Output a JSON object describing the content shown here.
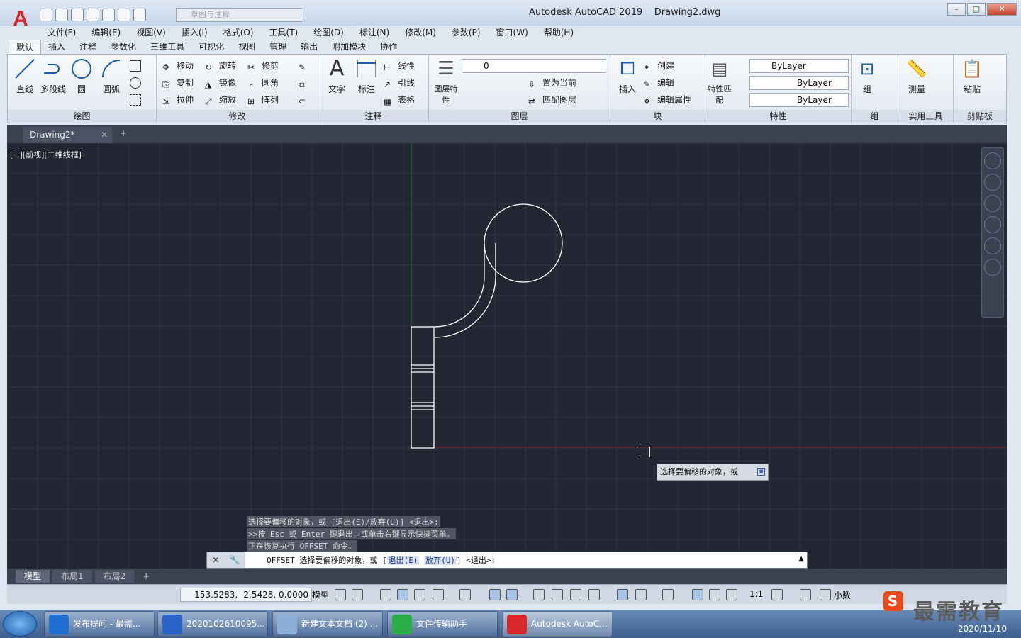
{
  "app": {
    "title": "Autodesk AutoCAD 2019",
    "document": "Drawing2.dwg",
    "logo": "A",
    "workspace": "草图与注释"
  },
  "menu": [
    "文件(F)",
    "编辑(E)",
    "视图(V)",
    "插入(I)",
    "格式(O)",
    "工具(T)",
    "绘图(D)",
    "标注(N)",
    "修改(M)",
    "参数(P)",
    "窗口(W)",
    "帮助(H)"
  ],
  "ribbon_tabs": [
    "默认",
    "插入",
    "注释",
    "参数化",
    "三维工具",
    "可视化",
    "视图",
    "管理",
    "输出",
    "附加模块",
    "协作"
  ],
  "ribbon": {
    "draw": {
      "label": "绘图",
      "line": "直线",
      "polyline": "多段线",
      "circle": "圆",
      "arc": "圆弧"
    },
    "modify": {
      "label": "修改",
      "move": "移动",
      "rotate": "旋转",
      "trim": "修剪",
      "copy": "复制",
      "mirror": "镜像",
      "fillet": "圆角",
      "stretch": "拉伸",
      "scale": "缩放",
      "array": "阵列"
    },
    "annotation": {
      "label": "注释",
      "text": "文字",
      "dimension": "标注",
      "linear": "线性",
      "leader": "引线",
      "table": "表格"
    },
    "layers": {
      "label": "图层",
      "props": "图层特性",
      "current_layer": "0",
      "make_current": "置为当前",
      "match": "匹配图层"
    },
    "block": {
      "label": "块",
      "insert": "插入",
      "create": "创建",
      "edit": "编辑",
      "edit_attr": "编辑属性"
    },
    "properties": {
      "label": "特性",
      "match": "特性匹配",
      "color": "ByLayer",
      "linetype": "ByLayer",
      "lineweight": "ByLayer"
    },
    "groups": {
      "label": "组",
      "group": "组"
    },
    "utilities": {
      "label": "实用工具",
      "measure": "测量"
    },
    "clipboard": {
      "label": "剪贴板",
      "paste": "粘贴"
    }
  },
  "doc_tab": "Drawing2*",
  "viewport_label": "[−][前视][二维线框]",
  "tooltip": "选择要偏移的对象，或",
  "command_history": [
    "选择要偏移的对象，或 [退出(E)/放弃(U)] <退出>:",
    ">>按 Esc 或 Enter 键退出，或单击右键显示快捷菜单。",
    "正在恢复执行 OFFSET 命令。"
  ],
  "command_line": {
    "prefix": "OFFSET 选择要偏移的对象，或 [",
    "opt1": "退出(E)",
    "opt2": "放弃(U)",
    "suffix": "] <退出>:"
  },
  "layout_tabs": [
    "模型",
    "布局1",
    "布局2"
  ],
  "status": {
    "coords": "153.5283, -2.5428, 0.0000",
    "model": "模型",
    "scale": "1:1",
    "units": "小数"
  },
  "taskbar": [
    {
      "label": "发布提问 - 最需...",
      "color": "#1e6fd0"
    },
    {
      "label": "2020102610095...",
      "color": "#2a64c8"
    },
    {
      "label": "新建文本文档 (2) ...",
      "color": "#8ab0d8"
    },
    {
      "label": "文件传输助手",
      "color": "#2aae47"
    },
    {
      "label": "Autodesk AutoC...",
      "color": "#d8262b"
    }
  ],
  "clock": "2020/11/10",
  "watermark": {
    "text": "最需教育",
    "logo": "S"
  },
  "colors": {
    "canvas": "#222733",
    "grid": "#2e3442",
    "y_axis": "#1f7a2b",
    "x_axis": "#7a1f1f",
    "geometry": "#ffffff"
  }
}
